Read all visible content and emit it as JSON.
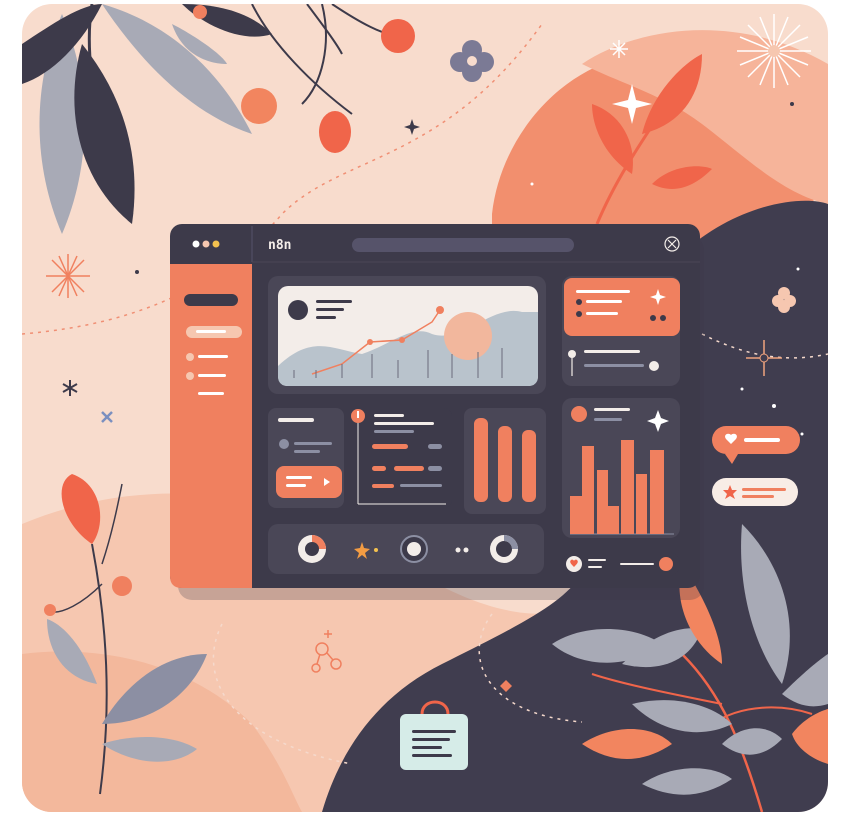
{
  "window": {
    "title": "n8n"
  },
  "colors": {
    "background": "#f8dccd",
    "accent": "#f0805f",
    "dark": "#3d3a4a",
    "panel": "#4a4757",
    "light_panel": "#f3ede9",
    "muted": "#a8aab6"
  },
  "icons": {
    "close": "close-icon",
    "sparkle": "sparkle-icon",
    "heart": "heart-icon",
    "star": "star-icon",
    "calendar": "calendar-icon"
  }
}
